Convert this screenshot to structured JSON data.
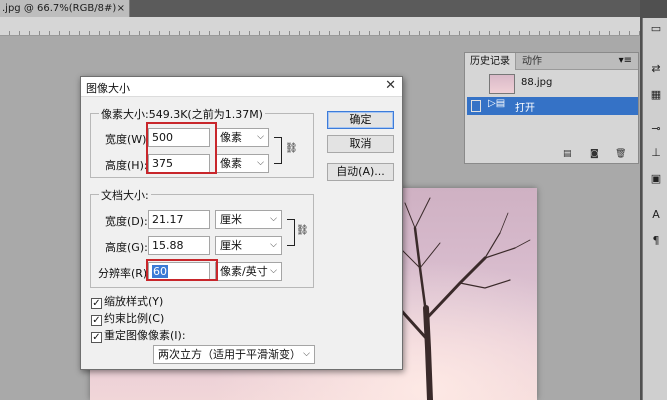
{
  "document_tab": {
    "title": ".jpg @ 66.7%(RGB/8#)",
    "close_symbol": "×"
  },
  "history_panel": {
    "tabs": [
      "历史记录",
      "动作"
    ],
    "menu_symbol": "▾≡",
    "snapshot": "88.jpg",
    "steps": [
      {
        "label": "打开"
      }
    ]
  },
  "dialog": {
    "title": "图像大小",
    "close_symbol": "✕",
    "pixel_dimensions": {
      "title": "像素大小:549.3K(之前为1.37M)",
      "width_label": "宽度(W):",
      "width_value": "500",
      "width_unit": "像素",
      "height_label": "高度(H):",
      "height_value": "375",
      "height_unit": "像素"
    },
    "document_size": {
      "title": "文档大小:",
      "width_label": "宽度(D):",
      "width_value": "21.17",
      "width_unit": "厘米",
      "height_label": "高度(G):",
      "height_value": "15.88",
      "height_unit": "厘米",
      "resolution_label": "分辨率(R):",
      "resolution_value": "60",
      "resolution_unit": "像素/英寸"
    },
    "buttons": {
      "ok": "确定",
      "cancel": "取消",
      "auto": "自动(A)..."
    },
    "options": {
      "scale_styles": "缩放样式(Y)",
      "constrain_proportions": "约束比例(C)",
      "resample": "重定图像像素(I):",
      "method": "两次立方（适用于平滑渐变）"
    },
    "check_mark": "✓"
  },
  "colors": {
    "selection": "#3572c6",
    "highlight": "#c8262b"
  }
}
